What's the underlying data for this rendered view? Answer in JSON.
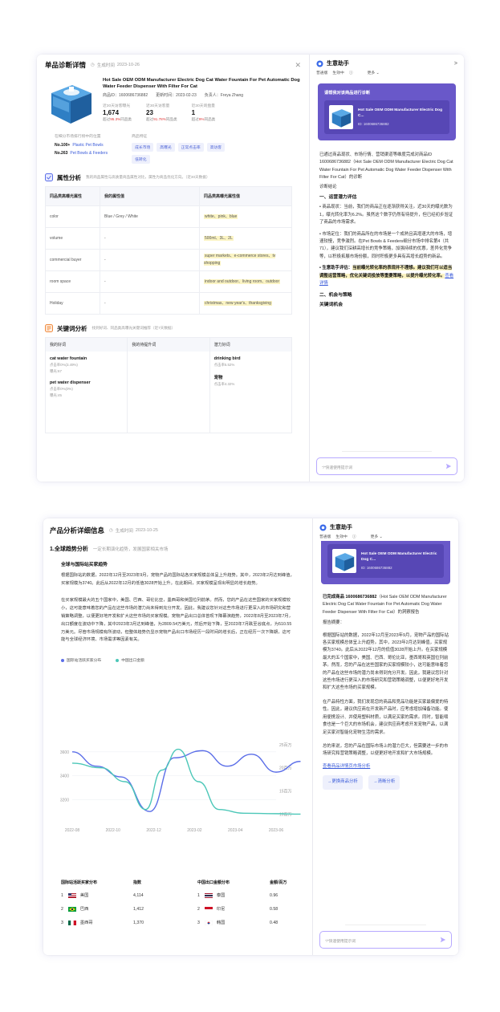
{
  "frame1": {
    "title": "单品诊断详情",
    "generated_label": "生成时间",
    "generated_time": "2023-10-26",
    "product_name": "Hot Sale OEM ODM Manufacturer Electric Dog Cat Water Fountain For Pet Automatic Dog Water Feeder Dispenser With Filter For Cat",
    "product_id": "商品ID：1600686736882",
    "updated": "更新时间：2023-02-23",
    "owner": "负责人：Freya Zhang",
    "stats": [
      {
        "label": "近30天访客曝光",
        "value": "1,674",
        "change_prefix": "超过",
        "change_pct": "95.3%",
        "change_suffix": "同品类"
      },
      {
        "label": "近30天访客量",
        "value": "23",
        "change_prefix": "超过",
        "change_pct": "91.78%",
        "change_suffix": "同品类"
      },
      {
        "label": "近30天询盘量",
        "value": "1",
        "change_prefix": "超过",
        "change_pct": "9%",
        "change_suffix": "同品类"
      }
    ],
    "rank_label": "在细分市场排行榜中的位置",
    "ranks": [
      {
        "num": "No.100+",
        "cat": "Plastic Pet Bowls"
      },
      {
        "num": "No.263",
        "cat": "Pet Bowls & Feeders"
      }
    ],
    "tags_label": "商品特征",
    "tags": [
      "成长市场",
      "高曝光",
      "正常点击率",
      "高访客",
      "低转化"
    ],
    "attr_section_title": "属性分析",
    "attr_section_desc": "我的商品属性与高质量商品属性对比，属性为商品优化方向。（近30天数据）",
    "attr_headers": [
      "同品类高曝光属性",
      "我的属性值",
      "同品类高曝光属性值"
    ],
    "attr_rows": [
      {
        "name": "color",
        "mine": "Blue / Grey / White",
        "top": "white、pink、blue"
      },
      {
        "name": "volume",
        "mine": "-",
        "top": "500ml、3L、2L"
      },
      {
        "name": "commercial buyer",
        "mine": "-",
        "top": "super markets、e-commerce stores、tv shopping"
      },
      {
        "name": "room space",
        "mine": "-",
        "top": "indoor and outdoor、living room、outdoor"
      },
      {
        "name": "Holiday",
        "mine": "-",
        "top": "christmas、new year's、thanksgiving"
      }
    ],
    "kw_section_title": "关键词分析",
    "kw_section_desc": "找到好词、同品类高曝光关键词推荐（近7天数据）",
    "kw_headers": [
      "我的好词",
      "我的待提升词",
      "潜力好词"
    ],
    "kw_col1": [
      {
        "name": "cat water fountain",
        "s1": "点击率0%(3.49%)",
        "s2": "曝光:67"
      },
      {
        "name": "pet water dispenser",
        "s1": "点击率0%(0%)",
        "s2": "曝光:45"
      }
    ],
    "kw_col3": [
      {
        "name": "drinking bird",
        "s1": "点击率5.52%"
      },
      {
        "name": "宠物",
        "s1": "点击率4.32%"
      }
    ],
    "assistant": {
      "title": "生意助手",
      "sub_mode": "普通版",
      "sub_status": "生效中",
      "more": "更多",
      "card_title": "请帮我对该商品进行诊断",
      "card_product": "Hot Sale OEM ODM Manufacturer Electric Dog C...",
      "card_id": "ID: 1600686736882",
      "intro": "已通过商品现状、市场行情、营销渠道等维度完成对商品ID 1600686736882（Hot Sale OEM ODM Manufacturer Electric Dog Cat Water Fountain For Pet Automatic Dog Water Feeder Dispenser With Filter For Cat）的诊断",
      "diag_label": "诊断结论",
      "s1_title": "一、运营潜力评估",
      "s1_p1": "• 商品现状：当前，我们的商品正在逐渐获得关注。近30天的曝光数为1，曝光转化率为6.2%。虽然这个数字仍然有待提升，但已经初步验证了商品的市场需求。",
      "s1_p2": "• 市场定位：我们的商品所在的市场是一个成熟且高增速大的市场，增速较慢，竞争激烈。在Pet Bowls & Feeders细分市场中排名第4（共71），建议我们深耕高增长的竞争策略，加强持续的优惠，差异化竞争等，以积极拓展市场份额，同时积极更多具有高增长趋势的新品。",
      "s1_p3_prefix": "• 生意助手评估：",
      "s1_p3_bold": "当前曝光转化率的表现并不理想。建议我们可以适当调整运营策略，优化关键词投放等重要策略，以提升曝光转化率。",
      "s1_p3_link": "查看详情",
      "s2_title": "二、机会与策略",
      "s2_sub": "关键词机会",
      "input_ph": "“/”快速使用提示词"
    }
  },
  "frame2": {
    "title": "产品分析详细信息",
    "generated_label": "生成时间",
    "generated_time": "2023-10-25",
    "sec_title": "1.全球趋势分析",
    "sec_desc": "一定长期演化趋势，发展国家相关市场",
    "sub_title": "全球与国际站买家趋势",
    "para1": "根据国际站的数据，2022年12月至2023年9月，宠物产品的国际站各买家规模总体呈上升趋势。其中，2023年2月达到峰值，买家规模为3740。此后从2022年12月的低值3028开始上升。在此期间，买家规模呈现出明显的增长趋势。",
    "para2": "在买家规模最大的五个国家中，美国、巴西、哥伦比亚，墨西哥和英国位列前茅。然而，您的产品在这些国家的买家规模较小，这可能意味着您的产品在这些市场的潜力尚未得到充分开发。因此，我建议您针对这些市场进行更深入的市场研究和营销策略调整，以便更好地开发和扩大这些市场的买家规模。宠物产品出口总体曾现下降幕演趋势，2022年8月至2023年7月，出口额度在波动中下降，其中2023年3月达到峰值，为2809.54万美元，然后开始下降，至2023年7月跌至谷底点，为510.55万美元。尽管市场规模有所波动，但整体趋势仍显示宠物产品出口市场经历一段时间的增长后，正在经历一次下降期，这可能与全球经济环境、市场需求等因素有关。",
    "legend": [
      "国际站活跃买家分布",
      "中国出口金额"
    ],
    "chart_data": {
      "type": "line",
      "x": [
        "2022-08",
        "2022-10",
        "2022-12",
        "2023-02",
        "2023-04",
        "2023-06"
      ],
      "left_ticks": [
        "3600",
        "3400",
        "3200"
      ],
      "right_ticks": [
        "25百万",
        "20百万",
        "15百万",
        "10百万"
      ],
      "series": [
        {
          "name": "国际站活跃买家分布",
          "color": "#5b6ee8",
          "points": [
            [
              0,
              3600
            ],
            [
              0.6,
              3480
            ],
            [
              1.2,
              3390
            ],
            [
              1.9,
              3100
            ],
            [
              2.5,
              3550
            ],
            [
              3.2,
              3610
            ],
            [
              3.8,
              3480
            ],
            [
              4.4,
              3580
            ],
            [
              5.0,
              3430
            ],
            [
              5.6,
              3520
            ]
          ]
        },
        {
          "name": "中国出口金额",
          "color": "#4cc7b8",
          "points": [
            [
              0,
              21
            ],
            [
              0.7,
              20
            ],
            [
              1.3,
              17
            ],
            [
              1.8,
              11
            ],
            [
              2.2,
              19.5
            ],
            [
              2.6,
              24
            ],
            [
              3.1,
              17
            ],
            [
              3.6,
              11
            ],
            [
              4.2,
              10.2
            ],
            [
              5.0,
              10.1
            ],
            [
              5.6,
              10
            ]
          ]
        }
      ]
    },
    "ctry_left_headers": [
      "国际站活跃买家分布",
      "指数"
    ],
    "ctry_right_headers": [
      "中国出口金额分布",
      "金额/百万"
    ],
    "ctry_left": [
      {
        "rank": "1",
        "name": "美国",
        "val": "4,114"
      },
      {
        "rank": "2",
        "name": "巴西",
        "val": "1,412"
      },
      {
        "rank": "3",
        "name": "墨西哥",
        "val": "1,370"
      }
    ],
    "ctry_right": [
      {
        "rank": "1",
        "name": "泰国",
        "val": "0.96"
      },
      {
        "rank": "2",
        "name": "印尼",
        "val": "0.58"
      },
      {
        "rank": "3",
        "name": "韩国",
        "val": "0.48"
      }
    ],
    "assistant": {
      "title": "生意助手",
      "sub_mode": "普通版",
      "sub_status": "生效中",
      "more": "更多",
      "card_product": "Hot Sale OEM ODM Manufacturer Electric Dog C...",
      "card_id": "ID: 1600686736882",
      "intro_bold": "已完成商品 1600686736882",
      "intro_rest": "（Hot Sale OEM ODM Manufacturer Electric Dog Cat Water Fountain For Pet Automatic Dog Water Feeder Dispenser With Filter For Cat）的洞察报告",
      "report_label": "报告摘要：",
      "r1": "根据国际站的数据，2022年12月至2023年9月，宠物产品的国际站各买家规模总体呈上升趋势。其中，2023年2月达到峰值，买家规模为3740。此后从2022年12月的低值3028开始上升。在买家规模最大的五个国家中，美国、巴西、哥伦比亚，墨西哥和英国位列前茅。然而，您的产品在这些国家的买家规模较小，这可能意味着您的产品在这些市场的潜力尚未得到充分开发。因此，我建议您针对这些市场进行更深入的市场研究和营销策略调整，以便更好地开发和扩大这些市场的买家规模。",
      "r2": "在产品特性方面，我们发现您的商品和竞品功能是买家最偏爱的特性。因此，建议供应商在开发新产品时，应考虑增加储备功能。使用便携设计、并使用塑料材质，以满足买家的需求。同时，智能喂食也是一个巨大的市场机会，建议供应商考虑开发宠物产品，以满足买家对智能化宠物生活的需求。",
      "r3": "总的来说，您的产品在国际市场上的潜力巨大，但需要进一步的市场研究和营销策略调整，以便更好地开发和扩大市场规模。",
      "link": "查看商品详情页市场分析",
      "btn1": "→更换商品分析",
      "btn2": "→清晰分析",
      "input_ph": "“/”快速使用提示词"
    }
  }
}
